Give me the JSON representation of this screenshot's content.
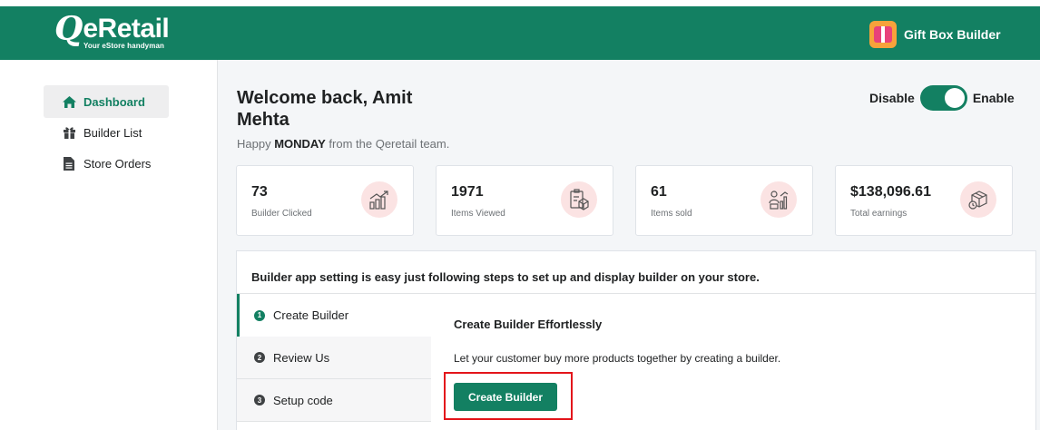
{
  "header": {
    "logo_q": "Q",
    "logo_text": "eRetail",
    "logo_tagline": "Your eStore handyman",
    "app_name": "Gift Box Builder",
    "colors": {
      "brand_green": "#138062",
      "highlight_red": "#e3151b"
    }
  },
  "sidebar": {
    "items": [
      {
        "label": "Dashboard",
        "icon": "home-icon",
        "active": true
      },
      {
        "label": "Builder List",
        "icon": "gift-icon",
        "active": false
      },
      {
        "label": "Store Orders",
        "icon": "document-icon",
        "active": false
      }
    ]
  },
  "main": {
    "welcome": "Welcome back, Amit Mehta",
    "greeting_prefix": "Happy ",
    "greeting_day": "MONDAY",
    "greeting_suffix": " from the Qeretail team.",
    "toggle": {
      "off_label": "Disable",
      "on_label": "Enable",
      "state": "enabled"
    },
    "stats": [
      {
        "value": "73",
        "label": "Builder Clicked",
        "icon": "chart-growth-icon"
      },
      {
        "value": "1971",
        "label": "Items Viewed",
        "icon": "clipboard-box-icon"
      },
      {
        "value": "61",
        "label": "Items sold",
        "icon": "sales-chart-icon"
      },
      {
        "value": "$138,096.61",
        "label": "Total earnings",
        "icon": "package-icon"
      }
    ],
    "setup": {
      "heading": "Builder app setting is easy just following steps to set up and display builder on your store.",
      "steps": [
        {
          "number": "1",
          "label": "Create Builder",
          "active": true
        },
        {
          "number": "2",
          "label": "Review Us",
          "active": false
        },
        {
          "number": "3",
          "label": "Setup code",
          "active": false
        }
      ],
      "panel_title": "Create Builder Effortlessly",
      "panel_description": "Let your customer buy more products together by creating a builder.",
      "button_label": "Create Builder"
    }
  }
}
